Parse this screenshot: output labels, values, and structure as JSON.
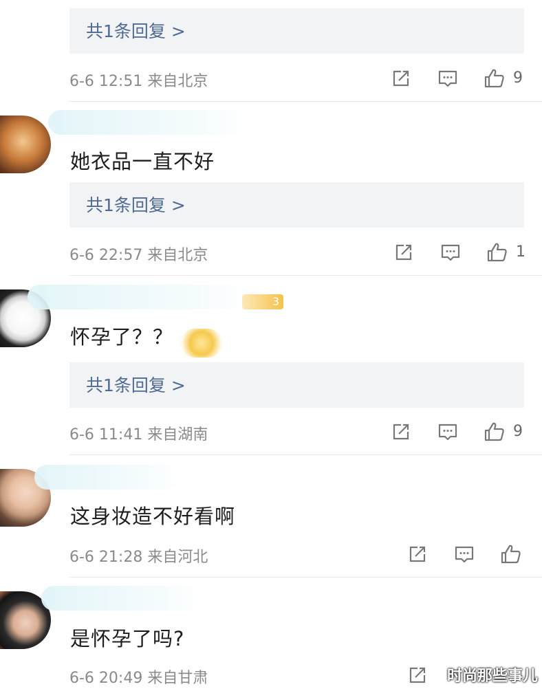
{
  "top_item": {
    "reply_label": "共1条回复 >",
    "meta": "6-6 12:51 来自北京",
    "like_count": "9"
  },
  "comments": [
    {
      "text": "她衣品一直不好",
      "reply_label": "共1条回复 >",
      "meta": "6-6 22:57 来自北京",
      "like_count": "1"
    },
    {
      "text": "怀孕了？？",
      "reply_label": "共1条回复 >",
      "meta": "6-6 11:41 来自湖南",
      "like_count": "9",
      "badge": "3"
    },
    {
      "text": "这身妆造不好看啊",
      "meta": "6-6 21:28 来自河北",
      "like_count": ""
    },
    {
      "text": "是怀孕了吗?",
      "meta": "6-6 20:49 来自甘肃",
      "like_count": ""
    }
  ],
  "watermark": "时尚那些事儿",
  "icons": {
    "share": "share-icon",
    "comment": "comment-icon",
    "like": "thumbs-up-icon"
  },
  "colors": {
    "reply_link": "#4e6a92",
    "reply_bg": "#f2f3f5",
    "meta": "#8a8a8a",
    "badge": "#f5c24a"
  }
}
